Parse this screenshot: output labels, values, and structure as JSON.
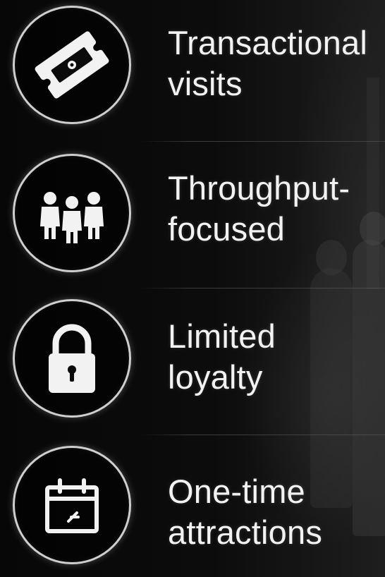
{
  "items": [
    {
      "icon": "ticket-icon",
      "line1": "Transactional",
      "line2": "visits"
    },
    {
      "icon": "group-people-icon",
      "line1": "Throughput-",
      "line2": "focused"
    },
    {
      "icon": "padlock-icon",
      "line1": "Limited",
      "line2": "loyalty"
    },
    {
      "icon": "calendar-icon",
      "line1": "One-time",
      "line2": "attractions"
    }
  ],
  "colors": {
    "background": "#0b0b0b",
    "icon": "#f2f2f2",
    "ring": "#cfcfcf",
    "text": "#f2f2f2"
  }
}
